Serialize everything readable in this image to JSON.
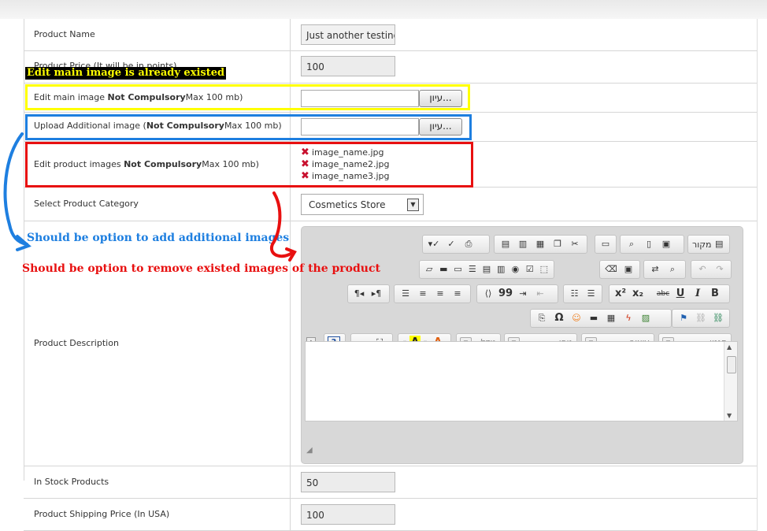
{
  "form": {
    "product_name": {
      "label": "Product Name",
      "value": "Just another testing"
    },
    "product_price": {
      "label": "Product Price (It will be in points)",
      "value": "100"
    },
    "edit_main_image": {
      "label_pre": "Edit main image ",
      "label_bold": "Not Compulsory",
      "label_post": "Max 100 mb)",
      "button": "עיון..."
    },
    "upload_additional": {
      "label_pre": "Upload Additional image (",
      "label_bold": "Not Compulsory",
      "label_post": "Max 100 mb)",
      "button": "עיון..."
    },
    "edit_product_images": {
      "label_pre": "Edit product images ",
      "label_bold": "Not Compulsory",
      "label_post": "Max 100 mb)",
      "images": [
        "image_name.jpg",
        "image_name2.jpg",
        "image_name3.jpg"
      ]
    },
    "category": {
      "label": "Select Product Category",
      "selected": "Cosmetics Store"
    },
    "description": {
      "label": "Product Description"
    },
    "in_stock": {
      "label": "In Stock Products",
      "value": "50"
    },
    "shipping": {
      "label": "Product Shipping Price (In USA)",
      "value": "100"
    }
  },
  "editor": {
    "source_label": "מקור",
    "combo_font": "גופן",
    "combo_size": "גודל",
    "combo_format": "עיצוב",
    "combo_style": "סגנון",
    "bold": "B",
    "italic": "I",
    "underline": "U",
    "strike": "abc",
    "superscript": "x²",
    "subscript": "x₂",
    "quote": "99",
    "help": "?"
  },
  "annotations": {
    "yellow_note": "Edit main image is already existed",
    "blue_note": "Should be option to add additional images",
    "red_note": "Should be option to remove existed images of the product",
    "colors": {
      "yellow": "#ffff00",
      "blue": "#1e7fe0",
      "red": "#e81010",
      "yellow_label_bg": "#000000"
    }
  }
}
